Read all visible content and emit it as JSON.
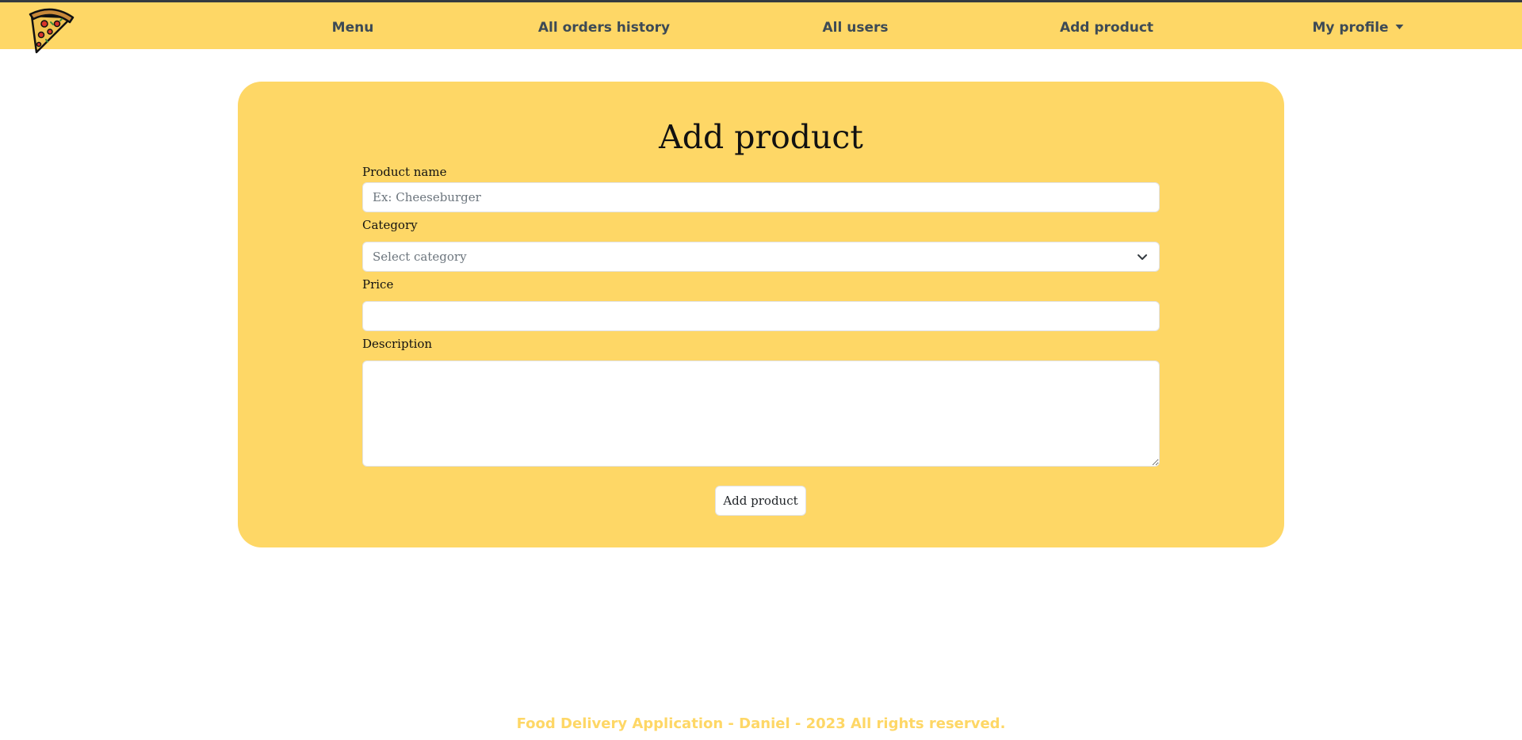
{
  "nav": {
    "items": [
      {
        "label": "Menu"
      },
      {
        "label": "All orders history"
      },
      {
        "label": "All users"
      },
      {
        "label": "Add product"
      }
    ],
    "profile_label": "My profile",
    "logo_icon": "pizza-slice-icon"
  },
  "form": {
    "title": "Add product",
    "product_name_label": "Product name",
    "product_name_placeholder": "Ex: Cheeseburger",
    "product_name_value": "",
    "category_label": "Category",
    "category_selected": "Select category",
    "price_label": "Price",
    "price_value": "",
    "description_label": "Description",
    "description_value": "",
    "submit_label": "Add product"
  },
  "footer": {
    "text": "Food Delivery Application - Daniel - 2023 All rights reserved."
  },
  "colors": {
    "brand_yellow": "#fed766",
    "nav_text": "#3d4a55",
    "top_line": "#343a40"
  }
}
